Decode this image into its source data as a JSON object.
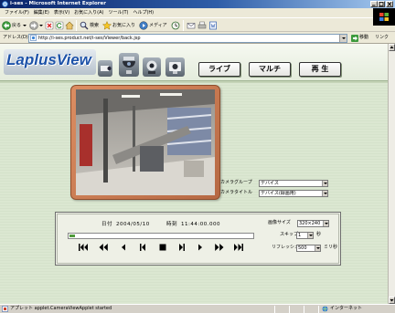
{
  "window": {
    "title": "i-ses - Microsoft Internet Explorer"
  },
  "menu": {
    "items": [
      "ファイル(F)",
      "編集(E)",
      "表示(V)",
      "お気に入り(A)",
      "ツール(T)",
      "ヘルプ(H)"
    ]
  },
  "toolbar": {
    "back_label": "戻る",
    "search_label": "検索",
    "favorites_label": "お気に入り",
    "media_label": "メディア"
  },
  "address": {
    "label": "アドレス(D)",
    "url": "http://i-ses.product.net/i-ses/Viewer/back.jsp",
    "go_label": "移動",
    "links_label": "リンク"
  },
  "app": {
    "logo": "LaplusView",
    "camera_icons": [
      "box-camera-icon",
      "dome-camera-icon",
      "ptz-camera-icon",
      "fixed-camera-icon"
    ],
    "nav": {
      "live": "ライブ",
      "multi": "マルチ",
      "playback": "再 生"
    }
  },
  "camera": {
    "group_label": "カメラグループ",
    "group_value": "デバイス",
    "title_label": "カメラタイトル",
    "title_value": "デバイス(録画用)"
  },
  "playback": {
    "date_label": "日付",
    "date": "2004/05/10",
    "time_label": "時刻",
    "time": "11:44:00.000",
    "position": 0,
    "size_label": "画像サイズ",
    "size_value": "320×240",
    "skip_label": "スキップ",
    "skip_value": "1",
    "skip_unit": "秒",
    "refresh_label": "リフレッシュ",
    "refresh_value": "500",
    "refresh_unit": "ミリ秒",
    "controls": [
      "skip-to-start-icon",
      "fast-rewind-icon",
      "reverse-play-icon",
      "step-back-icon",
      "stop-icon",
      "step-forward-icon",
      "play-icon",
      "fast-forward-icon",
      "skip-to-end-icon"
    ]
  },
  "status": {
    "text": "アプレット applet.CameraViewApplet started",
    "zone": "インターネット"
  },
  "colors": {
    "brand": "#1d52a8",
    "video_frame": "#c97a52",
    "background": "#dae6d0"
  }
}
